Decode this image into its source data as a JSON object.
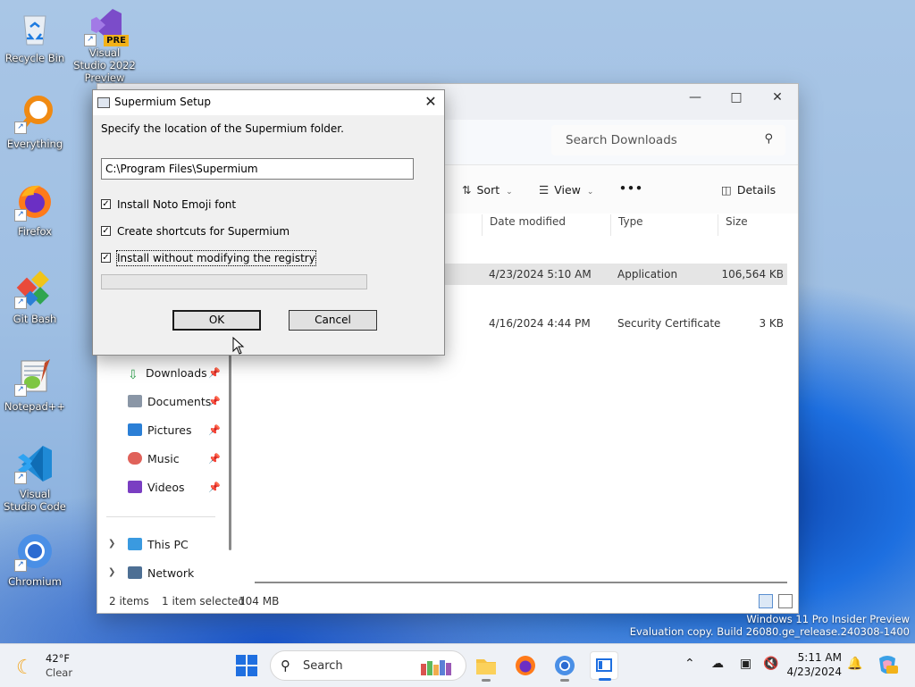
{
  "desktop": {
    "icons": [
      {
        "label": "Recycle Bin",
        "icon": "recycle-bin-icon"
      },
      {
        "label": "Visual Studio 2022 Preview",
        "icon": "visual-studio-icon",
        "badge": "PRE"
      },
      {
        "label": "Everything",
        "icon": "everything-search-icon"
      },
      {
        "label": "Firefox",
        "icon": "firefox-icon"
      },
      {
        "label": "Git Bash",
        "icon": "git-bash-icon"
      },
      {
        "label": "Notepad++",
        "icon": "notepad-plus-plus-icon"
      },
      {
        "label": "Visual Studio Code",
        "icon": "vscode-icon"
      },
      {
        "label": "Chromium",
        "icon": "chromium-icon"
      }
    ],
    "watermark": {
      "line1": "Windows 11 Pro Insider Preview",
      "line2": "Evaluation copy. Build 26080.ge_release.240308-1400"
    }
  },
  "explorer": {
    "search_placeholder": "Search Downloads",
    "toolbar": {
      "sort": "Sort",
      "view": "View",
      "more": "•••",
      "details": "Details"
    },
    "columns": {
      "date": "Date modified",
      "type": "Type",
      "size": "Size"
    },
    "files": [
      {
        "date": "4/23/2024 5:10 AM",
        "type": "Application",
        "size": "106,564 KB",
        "selected": true
      },
      {
        "date": "4/16/2024 4:44 PM",
        "type": "Security Certificate",
        "size": "3 KB",
        "selected": false
      }
    ],
    "nav": {
      "quick": [
        {
          "label": "Downloads",
          "icon": "downloads-icon",
          "color": "#2a9d4a"
        },
        {
          "label": "Documents",
          "icon": "documents-icon",
          "color": "#6c7a8c"
        },
        {
          "label": "Pictures",
          "icon": "pictures-icon",
          "color": "#2b7fd6"
        },
        {
          "label": "Music",
          "icon": "music-icon",
          "color": "#e0625a"
        },
        {
          "label": "Videos",
          "icon": "videos-icon",
          "color": "#7a3ec2"
        }
      ],
      "this_pc": "This PC",
      "network": "Network"
    },
    "status": {
      "items": "2 items",
      "selected": "1 item selected",
      "size": "104 MB"
    }
  },
  "dialog": {
    "title": "Supermium Setup",
    "instruction": "Specify the location of the Supermium folder.",
    "path": "C:\\Program Files\\Supermium",
    "options": [
      {
        "label": "Install Noto Emoji font",
        "checked": true
      },
      {
        "label": "Create shortcuts for Supermium",
        "checked": true
      },
      {
        "label": "Install without modifying the registry",
        "checked": true
      }
    ],
    "progress": 0,
    "ok": "OK",
    "cancel": "Cancel"
  },
  "taskbar": {
    "weather": {
      "temp": "42°F",
      "condition": "Clear"
    },
    "search": "Search",
    "clock": {
      "time": "5:11 AM",
      "date": "4/23/2024"
    }
  },
  "colors": {
    "accent": "#1f6fe0",
    "selection": "#e5e5e5"
  }
}
